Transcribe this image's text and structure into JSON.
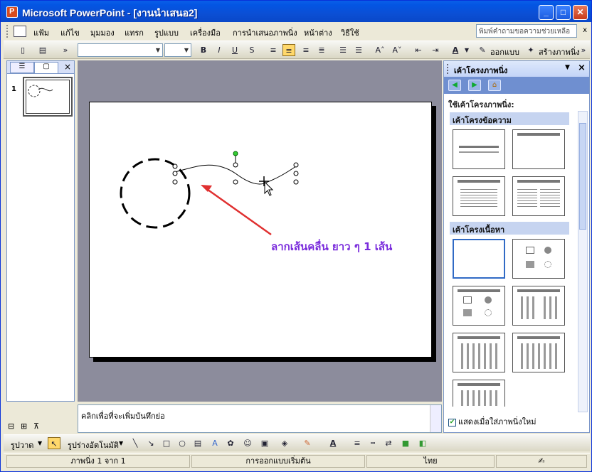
{
  "window": {
    "title": "Microsoft PowerPoint - [งานนำเสนอ2]"
  },
  "menu": {
    "items": [
      "แฟ้ม",
      "แก้ไข",
      "มุมมอง",
      "แทรก",
      "รูปแบบ",
      "เครื่องมือ",
      "การนำเสนอภาพนิ่ง",
      "หน้าต่าง",
      "วิธีใช้"
    ],
    "help_placeholder": "พิมพ์คำถามขอความช่วยเหลือ",
    "help_close": "x"
  },
  "toolbar": {
    "bold": "B",
    "italic": "I",
    "underline": "U",
    "shadow": "S",
    "design_label": "ออกแบบ",
    "new_slide_label": "สร้างภาพนิ่ง"
  },
  "left_pane": {
    "slide_number": "1",
    "close": "×"
  },
  "notes": {
    "placeholder": "คลิกเพื่อที่จะเพิ่มบันทึกย่อ"
  },
  "annotation": {
    "text": "ลากเส้นคลื่น ยาว ๆ 1 เส้น"
  },
  "task_pane": {
    "title": "เค้าโครงภาพนิ่ง",
    "subtitle": "ใช้เค้าโครงภาพนิ่ง:",
    "section_text": "เค้าโครงข้อความ",
    "section_content": "เค้าโครงเนื้อหา",
    "footer_label": "แสดงเมื่อใส่ภาพนิ่งใหม่",
    "close": "×"
  },
  "draw_toolbar": {
    "draw_label": "รูปวาด",
    "autoshapes_label": "รูปร่างอัตโนมัติ"
  },
  "status": {
    "slide": "ภาพนิ่ง 1 จาก 1",
    "design": "การออกแบบเริ่มต้น",
    "language": "ไทย"
  },
  "colors": {
    "titlebar": "#0355e3",
    "annotation": "#7a2cdc",
    "arrow": "#e03030",
    "workspace": "#8c8c9c"
  }
}
